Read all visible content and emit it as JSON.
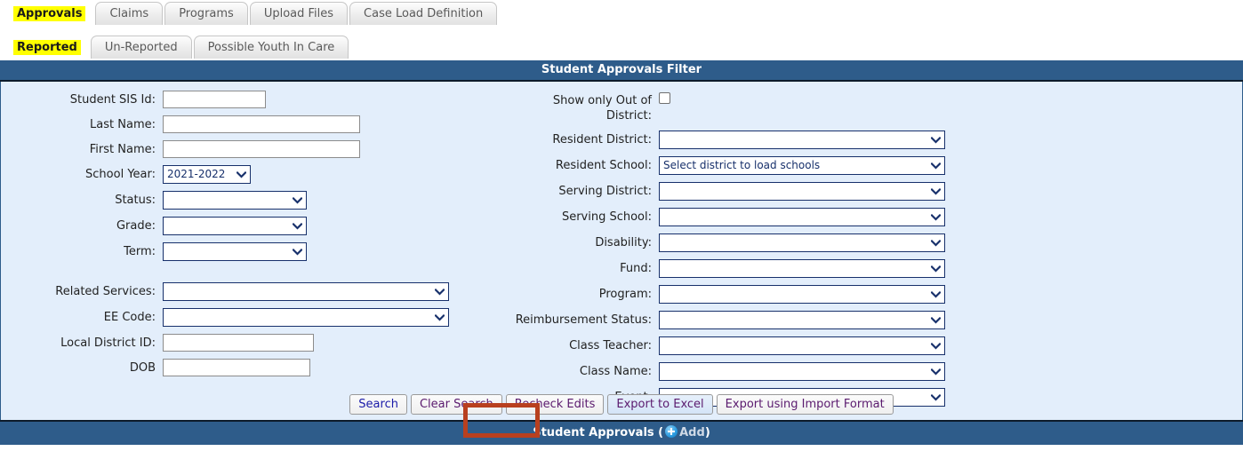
{
  "primary_tabs": [
    {
      "label": "Approvals",
      "active": true
    },
    {
      "label": "Claims",
      "active": false
    },
    {
      "label": "Programs",
      "active": false
    },
    {
      "label": "Upload Files",
      "active": false
    },
    {
      "label": "Case Load Definition",
      "active": false
    }
  ],
  "secondary_tabs": [
    {
      "label": "Reported",
      "active": true
    },
    {
      "label": "Un-Reported",
      "active": false
    },
    {
      "label": "Possible Youth In Care",
      "active": false
    }
  ],
  "filter": {
    "title": "Student Approvals Filter",
    "left": {
      "student_sis_id_label": "Student SIS Id:",
      "student_sis_id_value": "",
      "last_name_label": "Last Name:",
      "last_name_value": "",
      "first_name_label": "First Name:",
      "first_name_value": "",
      "school_year_label": "School Year:",
      "school_year_value": "2021-2022",
      "status_label": "Status:",
      "status_value": "",
      "grade_label": "Grade:",
      "grade_value": "",
      "term_label": "Term:",
      "term_value": "",
      "related_services_label": "Related Services:",
      "related_services_value": "",
      "ee_code_label": "EE Code:",
      "ee_code_value": "",
      "local_district_id_label": "Local District ID:",
      "local_district_id_value": "",
      "dob_label": "DOB",
      "dob_value": ""
    },
    "right": {
      "show_out_of_district_label_line1": "Show only Out of",
      "show_out_of_district_label_line2": "District:",
      "show_out_of_district_checked": false,
      "resident_district_label": "Resident District:",
      "resident_district_value": "",
      "resident_school_label": "Resident School:",
      "resident_school_value": "Select district to load schools",
      "serving_district_label": "Serving District:",
      "serving_district_value": "",
      "serving_school_label": "Serving School:",
      "serving_school_value": "",
      "disability_label": "Disability:",
      "disability_value": "",
      "fund_label": "Fund:",
      "fund_value": "",
      "program_label": "Program:",
      "program_value": "",
      "reimbursement_status_label": "Reimbursement Status:",
      "reimbursement_status_value": "",
      "class_teacher_label": "Class Teacher:",
      "class_teacher_value": "",
      "class_name_label": "Class Name:",
      "class_name_value": "",
      "event_label": "Event:",
      "event_value": ""
    },
    "buttons": {
      "search": "Search",
      "clear_search": "Clear Search",
      "recheck_edits": "Recheck Edits",
      "export_to_excel": "Export to Excel",
      "export_using_import_format": "Export using Import Format"
    }
  },
  "results_bar": {
    "title": "Student Approvals",
    "open_paren": "(",
    "add_label": "Add",
    "close_paren": ")"
  },
  "colors": {
    "banner": "#2e5c8a",
    "panel": "#e3eefb",
    "tab_highlight": "#ffff00",
    "annotation": "#b8401f",
    "select_border": "#17306b"
  }
}
